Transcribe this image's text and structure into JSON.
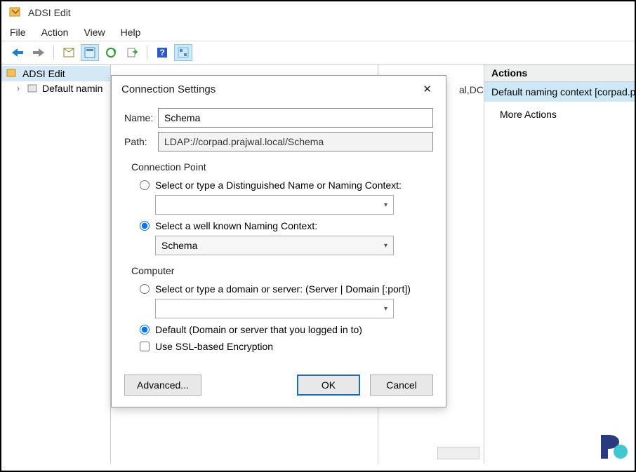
{
  "window": {
    "title": "ADSI Edit"
  },
  "menus": {
    "file": "File",
    "action": "Action",
    "view": "View",
    "help": "Help"
  },
  "tree": {
    "root": "ADSI Edit",
    "child": "Default namin"
  },
  "content": {
    "partial": "al,DC"
  },
  "actions": {
    "header": "Actions",
    "context": "Default naming context [corpad.prajw",
    "more": "More Actions"
  },
  "dialog": {
    "title": "Connection Settings",
    "name_label": "Name:",
    "name_value": "Schema",
    "path_label": "Path:",
    "path_value": "LDAP://corpad.prajwal.local/Schema",
    "conn_point": "Connection Point",
    "radio_dn": "Select or type a Distinguished Name or Naming Context:",
    "dn_value": "",
    "radio_wk": "Select a well known Naming Context:",
    "wk_value": "Schema",
    "computer": "Computer",
    "radio_domain": "Select or type a domain or server: (Server | Domain [:port])",
    "domain_value": "",
    "radio_default": "Default (Domain or server that you logged in to)",
    "check_ssl": "Use SSL-based Encryption",
    "advanced": "Advanced...",
    "ok": "OK",
    "cancel": "Cancel"
  }
}
